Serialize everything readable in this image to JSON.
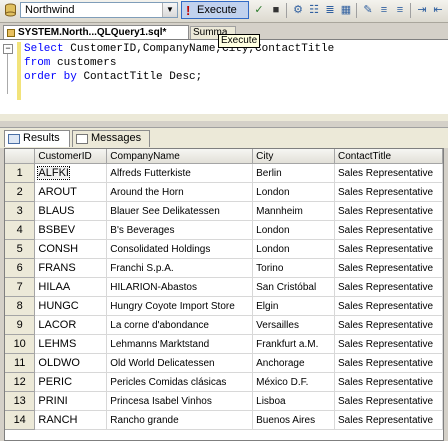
{
  "toolbar": {
    "database": "Northwind",
    "execute_label": "Execute",
    "icons": [
      "checkmark-icon",
      "stop-icon",
      "parse-icon",
      "display-plan-icon",
      "query-options-icon",
      "results-to-grid-icon",
      "results-to-text-icon",
      "comment-icon",
      "uncomment-icon",
      "indent-icon",
      "outdent-icon"
    ]
  },
  "tabs": {
    "document_tab": "SYSTEM.North...QLQuery1.sql*",
    "summary_tab": "Summa",
    "tooltip": "Execute"
  },
  "editor": {
    "lines": [
      "Select CustomerID,CompanyName,City,ContactTitle",
      "from customers",
      "order by ContactTitle Desc;"
    ]
  },
  "results": {
    "tab_results": "Results",
    "tab_messages": "Messages",
    "columns": [
      "CustomerID",
      "CompanyName",
      "City",
      "ContactTitle"
    ],
    "rows": [
      {
        "n": "1",
        "id": "ALFKI",
        "company": "Alfreds Futterkiste",
        "city": "Berlin",
        "title": "Sales Representative"
      },
      {
        "n": "2",
        "id": "AROUT",
        "company": "Around the Horn",
        "city": "London",
        "title": "Sales Representative"
      },
      {
        "n": "3",
        "id": "BLAUS",
        "company": "Blauer See Delikatessen",
        "city": "Mannheim",
        "title": "Sales Representative"
      },
      {
        "n": "4",
        "id": "BSBEV",
        "company": "B's Beverages",
        "city": "London",
        "title": "Sales Representative"
      },
      {
        "n": "5",
        "id": "CONSH",
        "company": "Consolidated Holdings",
        "city": "London",
        "title": "Sales Representative"
      },
      {
        "n": "6",
        "id": "FRANS",
        "company": "Franchi S.p.A.",
        "city": "Torino",
        "title": "Sales Representative"
      },
      {
        "n": "7",
        "id": "HILAA",
        "company": "HILARION-Abastos",
        "city": "San Cristóbal",
        "title": "Sales Representative"
      },
      {
        "n": "8",
        "id": "HUNGC",
        "company": "Hungry Coyote Import Store",
        "city": "Elgin",
        "title": "Sales Representative"
      },
      {
        "n": "9",
        "id": "LACOR",
        "company": "La corne d'abondance",
        "city": "Versailles",
        "title": "Sales Representative"
      },
      {
        "n": "10",
        "id": "LEHMS",
        "company": "Lehmanns Marktstand",
        "city": "Frankfurt a.M.",
        "title": "Sales Representative"
      },
      {
        "n": "11",
        "id": "OLDWO",
        "company": "Old World Delicatessen",
        "city": "Anchorage",
        "title": "Sales Representative"
      },
      {
        "n": "12",
        "id": "PERIC",
        "company": "Pericles Comidas clásicas",
        "city": "México D.F.",
        "title": "Sales Representative"
      },
      {
        "n": "13",
        "id": "PRINI",
        "company": "Princesa Isabel Vinhos",
        "city": "Lisboa",
        "title": "Sales Representative"
      },
      {
        "n": "14",
        "id": "RANCH",
        "company": "Rancho grande",
        "city": "Buenos Aires",
        "title": "Sales Representative"
      }
    ]
  }
}
